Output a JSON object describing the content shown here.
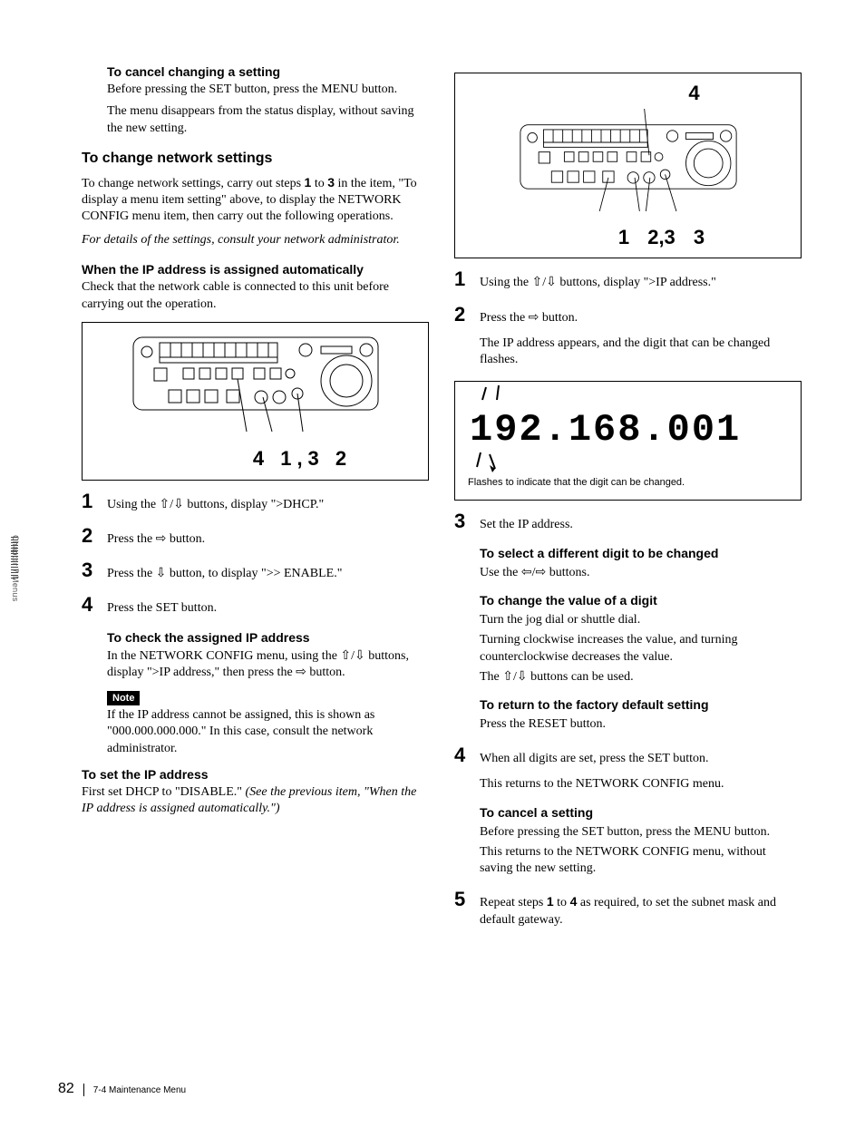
{
  "sidebar": {
    "label": "Chapter 7  Menus"
  },
  "footer": {
    "page": "82",
    "title": "7-4 Maintenance Menu"
  },
  "left": {
    "cancel_change": {
      "head": "To cancel changing a setting",
      "body1": "Before pressing the SET button, press the MENU button.",
      "body2": "The menu disappears from the status display, without saving the new setting."
    },
    "change_net": {
      "head": "To change network settings",
      "body_pre": "To change network settings, carry out steps ",
      "s1": "1",
      "to": " to ",
      "s2": "3",
      "body_post": " in the item, \"To display a menu item setting\" above, to display the NETWORK CONFIG menu item, then carry out the following operations.",
      "details": "For details of the settings, consult your network administrator."
    },
    "auto_ip": {
      "head": "When the IP address is assigned automatically",
      "body": "Check that the network cable is connected to this unit before carrying out the operation."
    },
    "diagram1_callouts": "4  1,3   2",
    "steps1": {
      "s1": "Using the ⇧/⇩ buttons, display \">DHCP.\"",
      "s2": "Press the ⇨ button.",
      "s3": "Press the ⇩ button, to display \">> ENABLE.\"",
      "s4": "Press the SET button."
    },
    "check_ip": {
      "head": "To check the assigned IP address",
      "body": "In the NETWORK CONFIG menu, using the ⇧/⇩ buttons, display \">IP address,\" then press the ⇨ button."
    },
    "note": {
      "label": "Note",
      "body": "If the IP address cannot be assigned, this is shown as \"000.000.000.000.\" In this case, consult the network administrator."
    },
    "set_ip": {
      "head": "To set the IP address",
      "body_pre": "First set DHCP to \"DISABLE.\" ",
      "body_ital": "(See the previous item, \"When the IP address is assigned automatically.\")"
    }
  },
  "right": {
    "diagram2_top": "4",
    "diagram2_bottom": "1    2,3   3",
    "steps_top": {
      "s1": "Using the ⇧/⇩ buttons, display \">IP address.\"",
      "s2": "Press the ⇨ button."
    },
    "ip_intro": "The IP address appears, and the digit that can be changed flashes.",
    "ip_value": "192.168.001",
    "ip_caption": "Flashes to indicate that the digit can be changed.",
    "steps_mid": {
      "s3_head": "Set the IP address.",
      "select_head": "To select a different digit to be changed",
      "select_body": "Use the ⇦/⇨ buttons.",
      "change_head": "To change the value of a digit",
      "change_b1": "Turn the jog dial or shuttle dial.",
      "change_b2": "Turning clockwise increases the value, and turning counterclockwise decreases the value.",
      "change_b3": "The ⇧/⇩ buttons can be used.",
      "return_head": "To return to the factory default setting",
      "return_body": "Press the RESET button.",
      "s4_a": "When all digits are set, press the SET button.",
      "s4_b": "This returns to the NETWORK CONFIG menu.",
      "cancel_head": "To cancel a setting",
      "cancel_b1": "Before pressing the SET button, press the MENU button.",
      "cancel_b2": "This returns to the NETWORK CONFIG menu, without saving the new setting.",
      "s5_pre": "Repeat steps ",
      "s5_1": "1",
      "s5_to": " to ",
      "s5_4": "4",
      "s5_post": " as required, to set the subnet mask and default gateway."
    }
  }
}
